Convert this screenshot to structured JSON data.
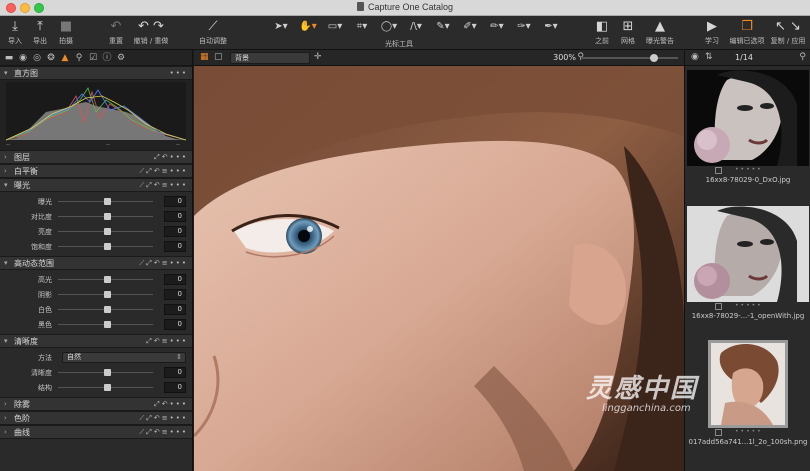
{
  "window": {
    "title": "Capture One Catalog"
  },
  "toolbar": {
    "import": "导入",
    "export": "导出",
    "capture": "拍摄",
    "reset": "重置",
    "undo_redo": "撤销 / 重做",
    "auto_adjust": "自动调整",
    "cursor_tools": "光标工具",
    "before": "之前",
    "grid": "网格",
    "exposure_warning": "曝光警告",
    "learn": "学习",
    "edit_selected": "编辑已选项",
    "copy_apply": "复制 / 应用"
  },
  "left": {
    "histogram": "直方图",
    "layers": "图层",
    "white_balance": "白平衡",
    "exposure": {
      "title": "曝光",
      "rows": [
        {
          "label": "曝光",
          "value": "0"
        },
        {
          "label": "对比度",
          "value": "0"
        },
        {
          "label": "亮度",
          "value": "0"
        },
        {
          "label": "饱和度",
          "value": "0"
        }
      ]
    },
    "hdr": {
      "title": "高动态范围",
      "rows": [
        {
          "label": "高光",
          "value": "0"
        },
        {
          "label": "阴影",
          "value": "0"
        },
        {
          "label": "白色",
          "value": "0"
        },
        {
          "label": "黑色",
          "value": "0"
        }
      ]
    },
    "clarity": {
      "title": "清晰度",
      "method_label": "方法",
      "method_value": "自然",
      "rows": [
        {
          "label": "清晰度",
          "value": "0"
        },
        {
          "label": "结构",
          "value": "0"
        }
      ]
    },
    "dehaze": "除雾",
    "levels": "色阶",
    "curves": "曲线"
  },
  "viewer": {
    "layer_select": "背景",
    "zoom": "300%"
  },
  "browser": {
    "count": "1/14",
    "items": [
      {
        "name": "16xx8-78029-0_DxO.jpg"
      },
      {
        "name": "16xx8-78029-...-1_openWith.jpg"
      },
      {
        "name": "017add56a741...1l_2o_100sh.png"
      }
    ]
  },
  "watermark": {
    "big": "灵感中国",
    "small": "lingganchina.com"
  }
}
